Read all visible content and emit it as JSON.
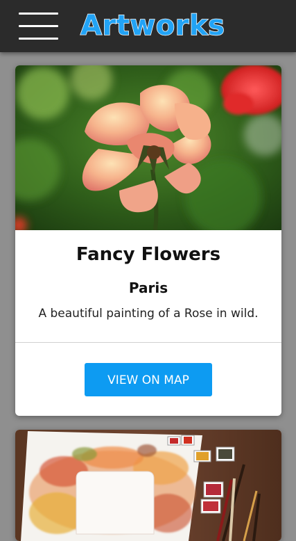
{
  "app_bar": {
    "title": "Artworks",
    "menu_icon": "hamburger-menu-icon",
    "background_color": "#2b2b2b",
    "title_color": "#22a3f5"
  },
  "cards": [
    {
      "image": "rose-flower-photo",
      "title": "Fancy Flowers",
      "subtitle": "Paris",
      "description": "A beautiful painting of a Rose in wild.",
      "button_label": "VIEW ON MAP",
      "button_color": "#0d9bf2"
    },
    {
      "image": "watercolor-leaves-painting-photo"
    }
  ]
}
